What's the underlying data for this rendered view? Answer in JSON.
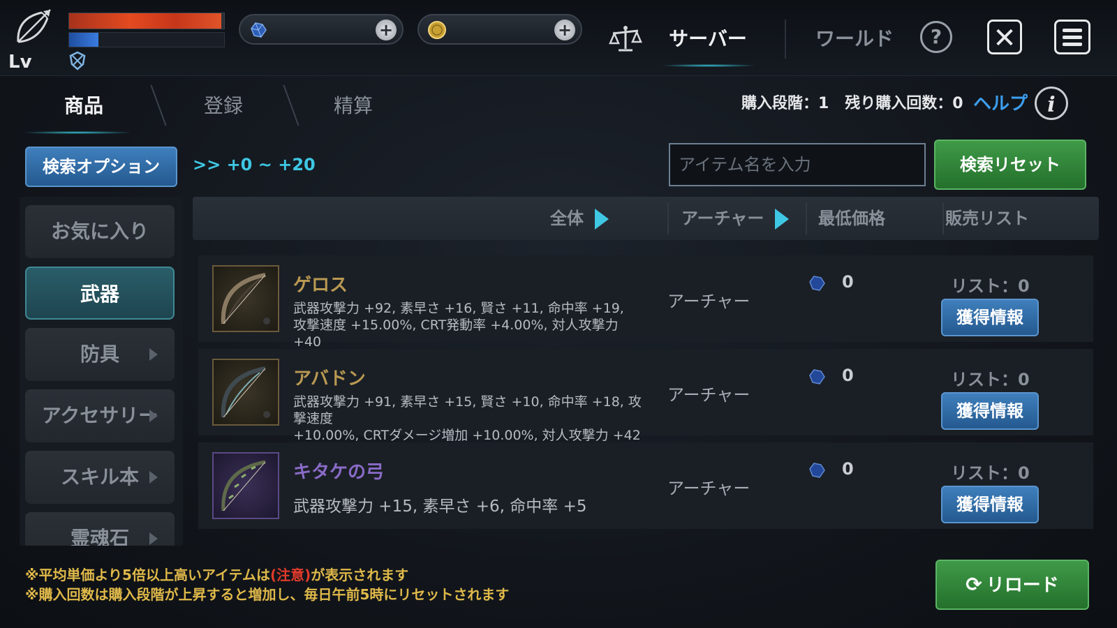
{
  "player": {
    "level_label": "Lv",
    "hp_percent": 0.98,
    "mp_percent": 0.19
  },
  "currencies": [
    {
      "name": "gem",
      "value": "",
      "icon": "blue-gem-icon"
    },
    {
      "name": "gold",
      "value": "",
      "icon": "gold-coin-icon"
    }
  ],
  "top_nav": {
    "server_tab": "サーバー",
    "world_tab": "ワールド",
    "help": "?",
    "close": "✕"
  },
  "sub_tabs": {
    "products": "商品",
    "register": "登録",
    "settle": "精算"
  },
  "purchase": {
    "stage_label": "購入段階：1",
    "remaining_label": "残り購入回数：0",
    "help_link": "ヘルプ",
    "info": "i"
  },
  "search": {
    "option_button": "検索オプション",
    "range": ">> +0 ~ +20",
    "placeholder": "アイテム名を入力",
    "reset_button": "検索リセット"
  },
  "sidebar": {
    "items": [
      {
        "label": "お気に入り",
        "active": false,
        "has_arrow": false
      },
      {
        "label": "武器",
        "active": true,
        "has_arrow": false
      },
      {
        "label": "防具",
        "active": false,
        "has_arrow": true
      },
      {
        "label": "アクセサリー",
        "active": false,
        "has_arrow": true
      },
      {
        "label": "スキル本",
        "active": false,
        "has_arrow": true
      },
      {
        "label": "霊魂石",
        "active": false,
        "has_arrow": true
      }
    ]
  },
  "table": {
    "headers": {
      "all": "全体",
      "job": "アーチャー",
      "min_price": "最低価格",
      "listings": "販売リスト"
    },
    "rows": [
      {
        "name": "ゲロス",
        "grade": "gold",
        "stats_line1": "武器攻撃力 +92, 素早さ +16, 賢さ +11, 命中率 +19,",
        "stats_line2": "攻撃速度 +15.00%, CRT発動率 +4.00%, 対人攻撃力 +40",
        "job": "アーチャー",
        "price": "0",
        "list": "リスト：0",
        "button": "獲得情報"
      },
      {
        "name": "アバドン",
        "grade": "gold",
        "stats_line1": "武器攻撃力 +91, 素早さ +15, 賢さ +10, 命中率 +18, 攻撃速度",
        "stats_line2": "+10.00%, CRTダメージ増加 +10.00%, 対人攻撃力 +42",
        "job": "アーチャー",
        "price": "0",
        "list": "リスト：0",
        "button": "獲得情報"
      },
      {
        "name": "キタケの弓",
        "grade": "purple",
        "stats_line1": "武器攻撃力 +15, 素早さ +6, 命中率 +5",
        "stats_line2": "",
        "job": "アーチャー",
        "price": "0",
        "list": "リスト：0",
        "button": "獲得情報"
      }
    ]
  },
  "footer": {
    "note1_a": "※平均単価より5倍以上高いアイテムは",
    "note1_warn": "(注意)",
    "note1_b": "が表示されます",
    "note2": "※購入回数は購入段階が上昇すると増加し、毎日午前5時にリセットされます",
    "reload_icon": "⟳",
    "reload": "リロード"
  },
  "colors": {
    "accent_cyan": "#3ec8e4",
    "help_blue": "#3c9ef0",
    "gold_name": "#b99952",
    "purple_name": "#8a6bc8",
    "warn_red": "#e03a2a",
    "note_yellow": "#e0b94a"
  }
}
